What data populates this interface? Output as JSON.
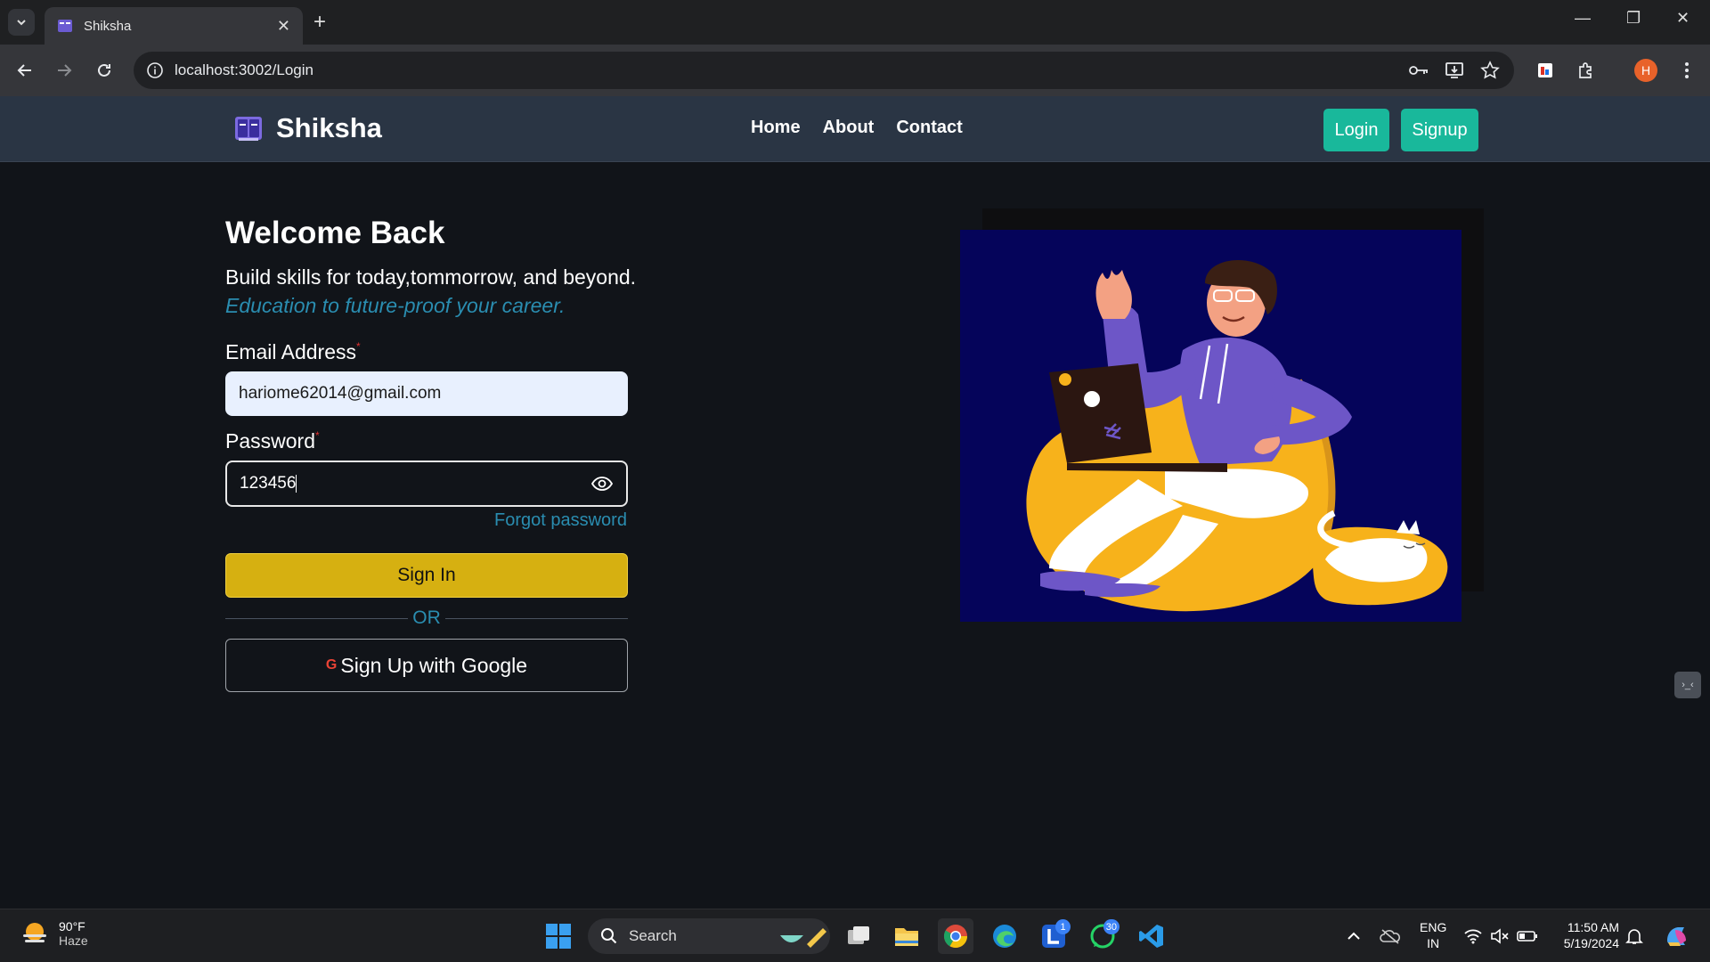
{
  "browser": {
    "tab_title": "Shiksha",
    "url": "localhost:3002/Login",
    "profile_initial": "H"
  },
  "site": {
    "brand": "Shiksha",
    "nav": [
      "Home",
      "About",
      "Contact"
    ],
    "login_label": "Login",
    "signup_label": "Signup"
  },
  "form": {
    "heading": "Welcome Back",
    "subtitle": "Build skills for today,tommorrow, and beyond.",
    "tagline": "Education to future-proof your career.",
    "email_label": "Email Address",
    "email_value": "hariome62014@gmail.com",
    "password_label": "Password",
    "password_value": "123456",
    "required_mark": "*",
    "forgot": "Forgot password",
    "signin": "Sign In",
    "or": "OR",
    "google": "Sign Up with Google",
    "google_glyph": "G"
  },
  "taskbar": {
    "temperature": "90°F",
    "condition": "Haze",
    "search": "Search",
    "lang1": "ENG",
    "lang2": "IN",
    "time": "11:50 AM",
    "date": "5/19/2024",
    "badge_l": "1",
    "badge_whatsapp": "30"
  },
  "colors": {
    "accent_teal": "#19b89b",
    "signin_yellow": "#d6b011",
    "link_blue": "#2a8db0",
    "nav_bg": "#2a3544"
  }
}
